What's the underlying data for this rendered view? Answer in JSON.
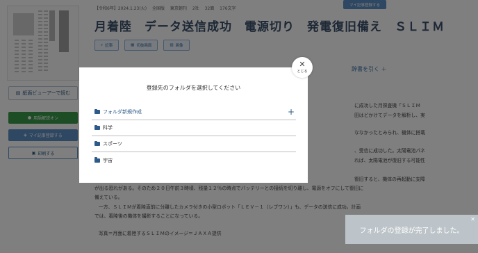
{
  "article": {
    "meta": [
      "【令和6年】2024.1.23(火)",
      "全国版",
      "東京朝刊",
      "2社",
      "32面",
      "176文字"
    ],
    "my_save_top": "マイ記事登録する",
    "headline": "月着陸　データ送信成功　電源切り　発電復旧備え　ＳＬＩＭ",
    "chips": [
      "記事",
      "切抜画面",
      "画像"
    ],
    "dictionary_link": "辞書を引く ＋",
    "body_lines": [
      "に成功した月探査機「ＳＬＩＭ",
      "田はどかけてデータを解析し、実",
      "ななかったとみられ、機体に搭載",
      "、受信に成功した。太陽電池パネ",
      "れば、太陽電池が復旧する可能性",
      "復旧すると、機体の再起動に支障",
      "が出る恐れがある。そのため２０日午前３時頃、残量１２％の時点でバッテリーとの接続を切り離し、電源をオフにして復旧に",
      "備えている。",
      "一方、ＳＬＩＭが着陸直前に分離したカメラ付きの小型ロボット「ＬＥＶ－１（レブワン）」も、データの送信に成功。計画",
      "では、着陸後の機体を撮影することになっている。",
      "写真＝月面に着陸するＳＬＩＭのイメージ＝ＪＡＸＡ提供"
    ]
  },
  "sidebar": {
    "viewer_button": "紙面ビューアーで読む",
    "explain_button": "用語解説オン",
    "mysave_button": "マイ記事登録する",
    "print_button": "印刷する"
  },
  "modal": {
    "title": "登録先のフォルダを選択してください",
    "new_folder": "フォルダ新規作成",
    "folders": [
      "科学",
      "スポーツ",
      "宇宙"
    ],
    "close_label": "とじる"
  },
  "toast": {
    "message": "フォルダの登録が完了しました。"
  }
}
